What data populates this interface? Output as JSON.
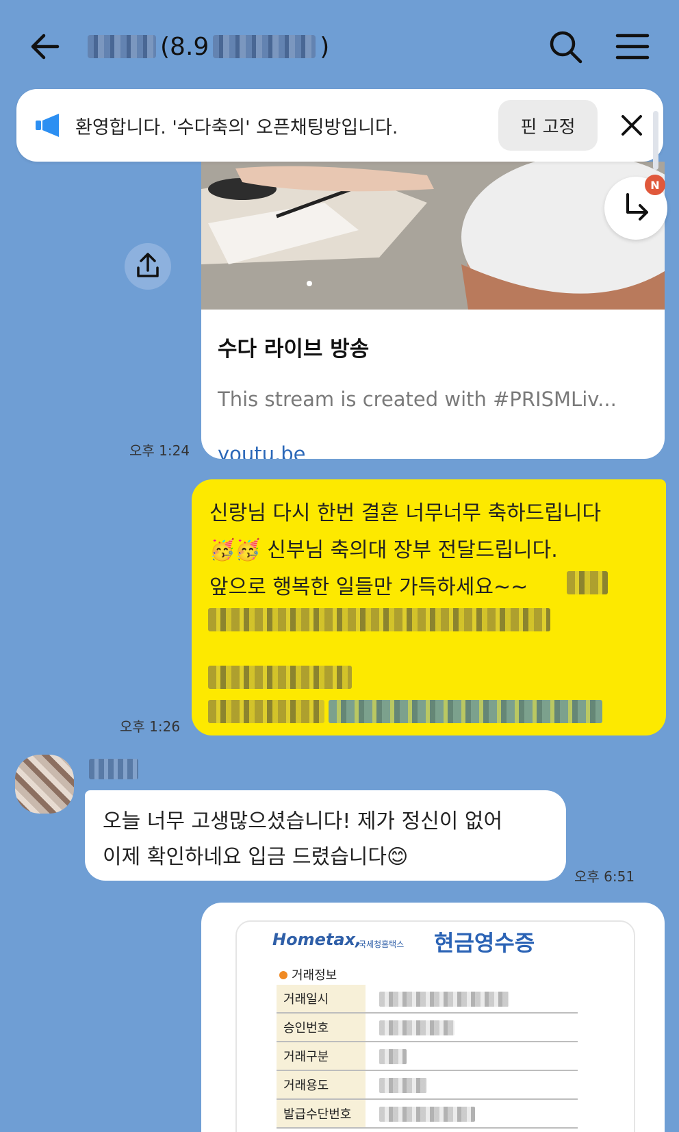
{
  "header": {
    "title_visible": "(8.9",
    "back_icon": "arrow-left-icon",
    "search_icon": "search-icon",
    "menu_icon": "hamburger-menu-icon"
  },
  "notice": {
    "icon": "megaphone-icon",
    "text": "환영합니다. '수다축의' 오픈채팅방입니다.",
    "pin_button": "핀 고정",
    "close_icon": "close-icon"
  },
  "jump_button": {
    "icon": "reply-arrow-icon",
    "badge": "N"
  },
  "messages": [
    {
      "type": "link",
      "title": "수다 라이브 방송",
      "description": "This stream is created with #PRISMLiv...",
      "domain": "youtu.be",
      "time": "오후 1:24",
      "share_icon": "share-icon"
    },
    {
      "type": "mine",
      "lines": [
        "신랑님 다시 한번 결혼 너무너무 축하드립니다",
        "🥳🥳 신부님 축의대 장부 전달드립니다.",
        "앞으로 행복한 일들만 가득하세요~~"
      ],
      "time": "오후 1:26"
    },
    {
      "type": "other",
      "lines": [
        "오늘 너무 고생많으셨습니다! 제가 정신이 없어",
        "이제 확인하네요 입금 드렸습니다😊"
      ],
      "time": "오후 6:51"
    },
    {
      "type": "image-receipt",
      "logo": "Hometax,",
      "logo_sub": "국세청홈택스",
      "title": "현금영수증",
      "section": "거래정보",
      "rows": [
        "거래일시",
        "승인번호",
        "거래구분",
        "거래용도",
        "발급수단번호"
      ]
    }
  ]
}
